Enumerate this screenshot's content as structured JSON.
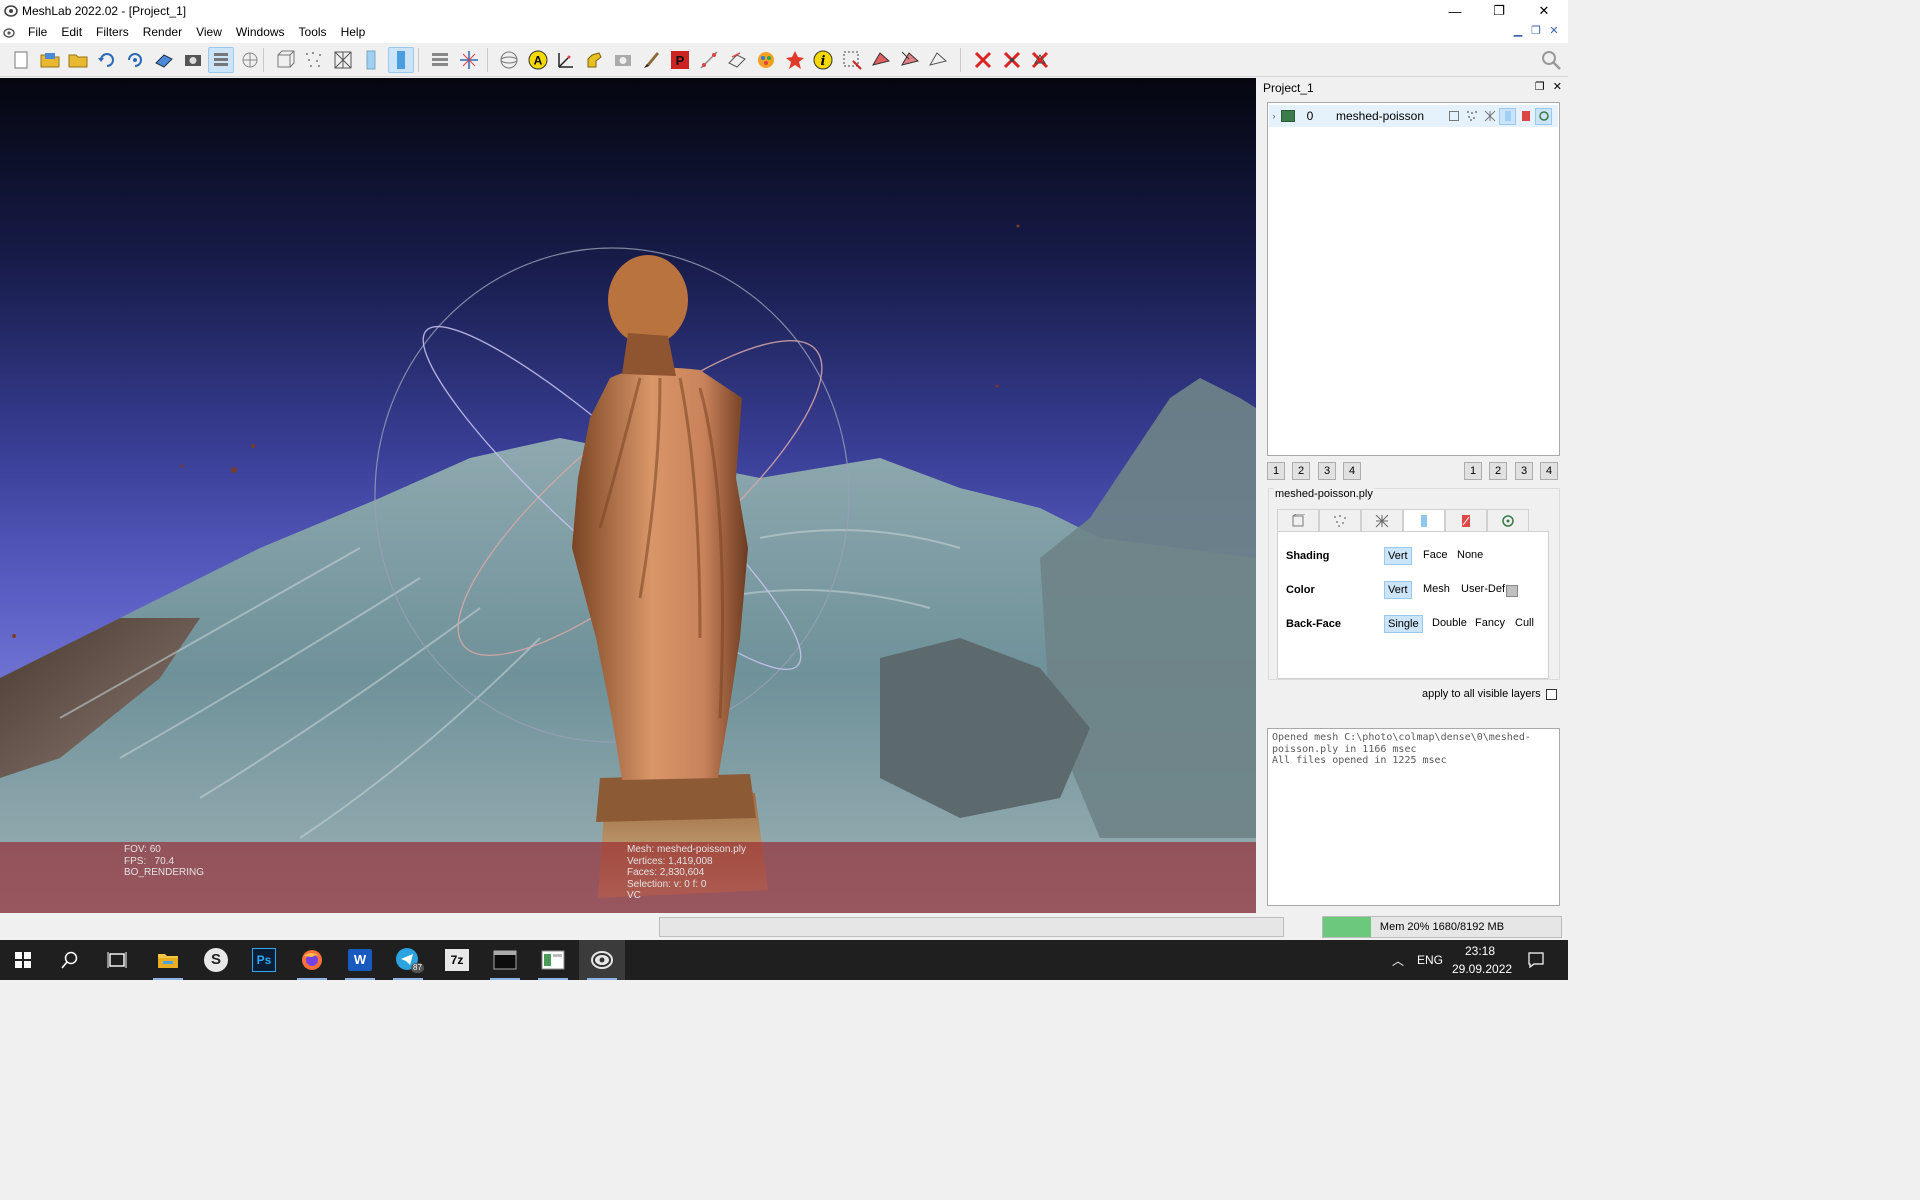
{
  "window": {
    "title": "MeshLab 2022.02 - [Project_1]",
    "controls": {
      "minimize": "—",
      "restore": "❐",
      "close": "✕"
    }
  },
  "menu": [
    "File",
    "Edit",
    "Filters",
    "Render",
    "View",
    "Windows",
    "Tools",
    "Help"
  ],
  "toolbar": {
    "groups": [
      [
        "new-project-icon",
        "open-project-icon",
        "import-mesh-icon",
        "reload-icon",
        "reload-all-icon",
        "export-mesh-icon",
        "snapshot-icon",
        "layers-icon",
        "raster-icon"
      ],
      [
        "bbox-icon",
        "points-icon",
        "wireframe-icon",
        "flat-shading-icon",
        "smooth-shading-icon"
      ],
      [
        "rotate-icon",
        "translate-icon",
        "sphere-icon",
        "annotation-a-icon",
        "axis-icon",
        "hand-icon",
        "camera-icon",
        "paint-brush-icon",
        "pick-points-icon",
        "measure-icon",
        "align-icon",
        "color-paint-icon",
        "georef-icon",
        "info-icon",
        "select-faces-icon",
        "select-vertices-icon",
        "select-connected-icon",
        "select-none-icon"
      ],
      [
        "delete-faces-icon",
        "delete-vertices-icon",
        "delete-selection-icon"
      ]
    ],
    "active": [
      "layers-icon",
      "smooth-shading-icon"
    ]
  },
  "viewport": {
    "info_left": [
      "FOV: 60",
      "FPS:   70.4",
      "BO_RENDERING"
    ],
    "info_right": [
      "Mesh: meshed-poisson.ply",
      "Vertices: 1,419,008",
      "Faces: 2,830,604",
      "Selection: v: 0 f: 0",
      "VC"
    ]
  },
  "panel": {
    "title": "Project_1",
    "layer": {
      "index": "0",
      "name": "meshed-poisson"
    },
    "left_nums": [
      "1",
      "2",
      "3",
      "4"
    ],
    "right_nums": [
      "1",
      "2",
      "3",
      "4"
    ],
    "render_title": "meshed-poisson.ply",
    "shading": {
      "label": "Shading",
      "options": [
        "Vert",
        "Face",
        "None"
      ],
      "selected": "Vert"
    },
    "color": {
      "label": "Color",
      "options": [
        "Vert",
        "Mesh",
        "User-Def"
      ],
      "selected": "Vert"
    },
    "backface": {
      "label": "Back-Face",
      "options": [
        "Single",
        "Double",
        "Fancy",
        "Cull"
      ],
      "selected": "Single"
    },
    "apply_all": "apply to all visible layers"
  },
  "log": "Opened mesh C:\\photo\\colmap\\dense\\0\\meshed-\npoisson.ply in 1166 msec\nAll files opened in 1225 msec",
  "status": {
    "memory_text": "Mem 20% 1680/8192 MB",
    "memory_fraction": 0.2
  },
  "taskbar": {
    "apps": [
      "start-icon",
      "search-icon",
      "task-view-icon",
      "file-explorer-icon",
      "s-app-icon",
      "photoshop-icon",
      "firefox-icon",
      "word-icon",
      "telegram-icon",
      "7zip-icon",
      "terminal-icon",
      "viewer-app-icon",
      "meshlab-icon"
    ],
    "ps_label": "Ps",
    "word_label": "W",
    "zip_label": "7z",
    "s_label": "S",
    "telegram_badge": "87",
    "lang": "ENG",
    "time": "23:18",
    "date": "29.09.2022"
  },
  "colors": {
    "accent": "#0078d7",
    "info_bar": "#961e28",
    "selected_bg": "#cce4f7"
  }
}
